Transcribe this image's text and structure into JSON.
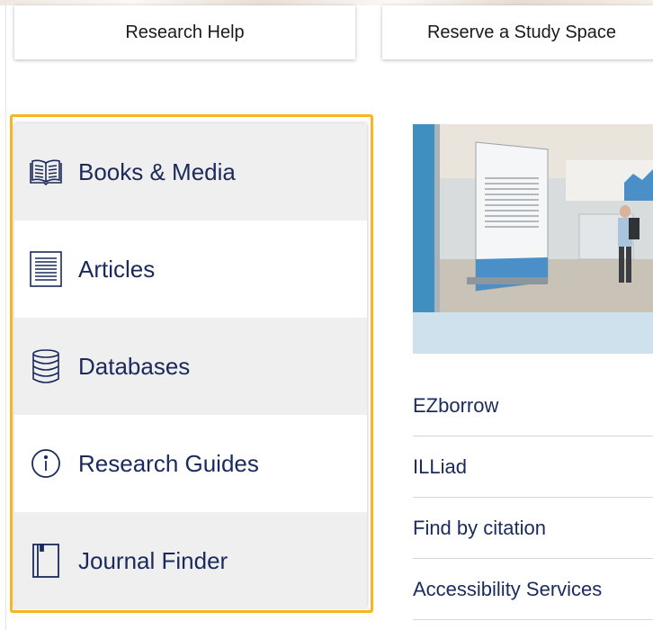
{
  "top_buttons": {
    "research_help": "Research Help",
    "reserve_study_space": "Reserve a Study Space"
  },
  "nav": {
    "items": [
      {
        "label": "Books & Media",
        "icon": "book-icon"
      },
      {
        "label": "Articles",
        "icon": "document-icon"
      },
      {
        "label": "Databases",
        "icon": "database-icon"
      },
      {
        "label": "Research Guides",
        "icon": "info-icon"
      },
      {
        "label": "Journal Finder",
        "icon": "journal-icon"
      }
    ],
    "colors": {
      "text": "#1b2a5c",
      "focus_outline": "#f7b51e",
      "shaded_row": "#efefef"
    }
  },
  "links": [
    "EZborrow",
    "ILLiad",
    "Find by citation",
    "Accessibility Services"
  ]
}
